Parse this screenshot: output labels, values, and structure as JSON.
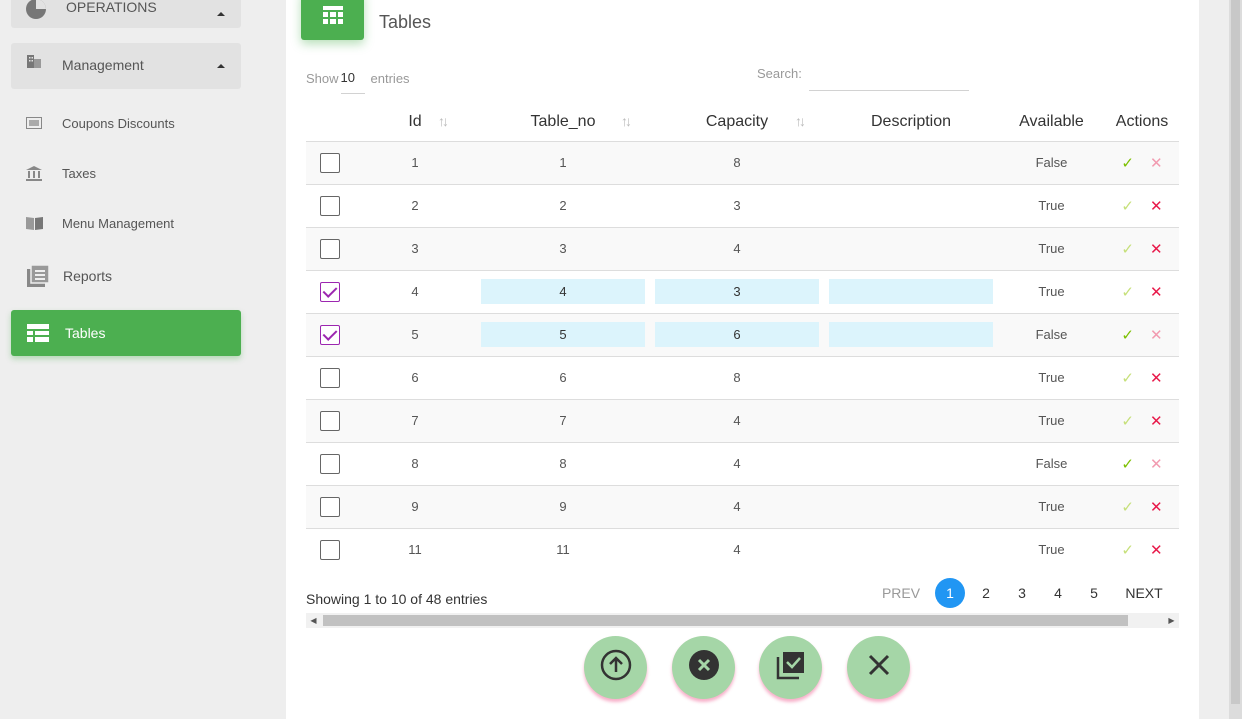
{
  "sidebar": {
    "groups": [
      {
        "label": "OPERATIONS",
        "icon": "pie-chart-icon"
      },
      {
        "label": "Management",
        "icon": "building-icon"
      }
    ],
    "items": [
      {
        "label": "Coupons Discounts",
        "icon": "ticket-icon"
      },
      {
        "label": "Taxes",
        "icon": "bank-icon"
      },
      {
        "label": "Menu Management",
        "icon": "book-icon"
      },
      {
        "label": "Reports",
        "icon": "list-icon"
      },
      {
        "label": "Tables",
        "icon": "table-icon",
        "active": true
      }
    ]
  },
  "page": {
    "title": "Tables",
    "show_label": "Show",
    "entries_value": "10",
    "entries_label": "entries",
    "search_label": "Search:"
  },
  "table": {
    "columns": [
      "Id",
      "Table_no",
      "Capacity",
      "Description",
      "Available",
      "Actions"
    ],
    "rows": [
      {
        "checked": false,
        "id": "1",
        "table_no": "1",
        "capacity": "8",
        "description": "",
        "available": "False",
        "editing": false
      },
      {
        "checked": false,
        "id": "2",
        "table_no": "2",
        "capacity": "3",
        "description": "",
        "available": "True",
        "editing": false
      },
      {
        "checked": false,
        "id": "3",
        "table_no": "3",
        "capacity": "4",
        "description": "",
        "available": "True",
        "editing": false
      },
      {
        "checked": true,
        "id": "4",
        "table_no": "4",
        "capacity": "3",
        "description": "",
        "available": "True",
        "editing": true
      },
      {
        "checked": true,
        "id": "5",
        "table_no": "5",
        "capacity": "6",
        "description": "",
        "available": "False",
        "editing": true
      },
      {
        "checked": false,
        "id": "6",
        "table_no": "6",
        "capacity": "8",
        "description": "",
        "available": "True",
        "editing": false
      },
      {
        "checked": false,
        "id": "7",
        "table_no": "7",
        "capacity": "4",
        "description": "",
        "available": "True",
        "editing": false
      },
      {
        "checked": false,
        "id": "8",
        "table_no": "8",
        "capacity": "4",
        "description": "",
        "available": "False",
        "editing": false
      },
      {
        "checked": false,
        "id": "9",
        "table_no": "9",
        "capacity": "4",
        "description": "",
        "available": "True",
        "editing": false
      },
      {
        "checked": false,
        "id": "11",
        "table_no": "11",
        "capacity": "4",
        "description": "",
        "available": "True",
        "editing": false
      }
    ]
  },
  "footer": {
    "info": "Showing 1 to 10 of 48 entries",
    "prev": "PREV",
    "next": "NEXT",
    "pages": [
      "1",
      "2",
      "3",
      "4",
      "5"
    ],
    "current_page": "1"
  },
  "fabs": [
    {
      "icon": "upload-circle-icon"
    },
    {
      "icon": "cancel-circle-icon"
    },
    {
      "icon": "select-all-icon"
    },
    {
      "icon": "close-icon"
    }
  ],
  "colors": {
    "accent": "#4caf50",
    "page_active": "#2196f3",
    "check": "#9c27b0",
    "action_ok": "#7cc000",
    "action_x": "#e8194a",
    "edit_cell": "#dcf4fc",
    "fab": "#a5d6a7"
  }
}
